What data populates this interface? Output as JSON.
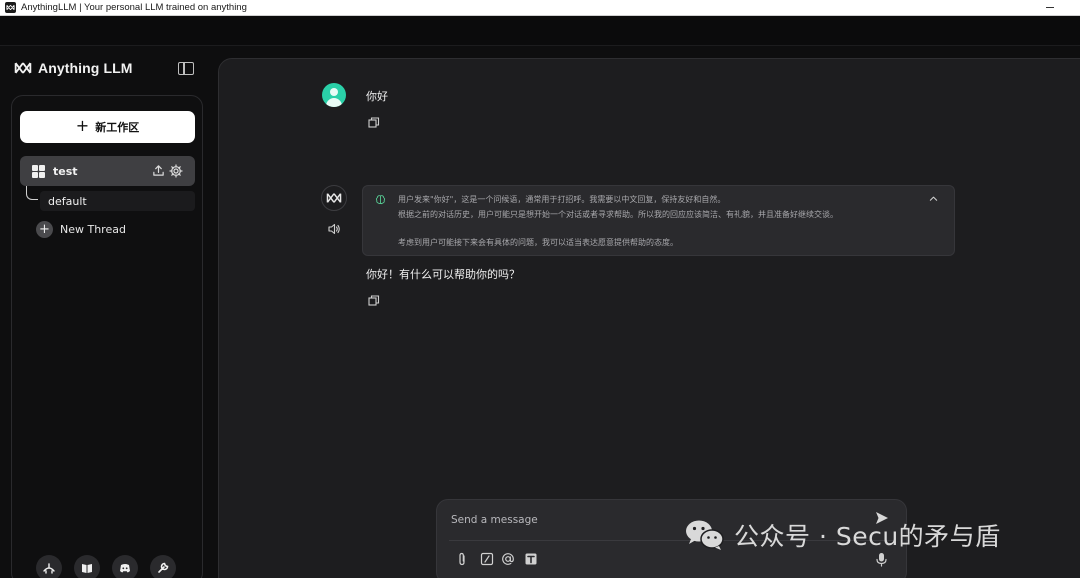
{
  "window": {
    "title": "AnythingLLM | Your personal LLM trained on anything"
  },
  "sidebar": {
    "brand": "Anything LLM",
    "new_workspace_label": "新工作区",
    "workspace": {
      "name": "test",
      "threads": [
        {
          "name": "default"
        }
      ]
    },
    "new_thread_label": "New Thread",
    "footer_icons": [
      "community-hub-icon",
      "docs-book-icon",
      "discord-icon",
      "settings-wrench-icon"
    ]
  },
  "chat": {
    "messages": [
      {
        "role": "user",
        "text": "你好"
      },
      {
        "role": "assistant",
        "thought": [
          "用户发来\"你好\"，这是一个问候语，通常用于打招呼。我需要以中文回复，保持友好和自然。",
          "根据之前的对话历史，用户可能只是想开始一个对话或者寻求帮助。所以我的回应应该简洁、有礼貌，并且准备好继续交谈。",
          "考虑到用户可能接下来会有具体的问题，我可以适当表达愿意提供帮助的态度。"
        ],
        "text": "你好！有什么可以帮助你的吗？"
      }
    ]
  },
  "composer": {
    "placeholder": "Send a message"
  },
  "watermark": {
    "text": "公众号 · Secu的矛与盾"
  },
  "colors": {
    "accent_avatar": "#2ad0a8",
    "background": "#0e0e0f",
    "panel": "#1d1d1f",
    "workspace_active": "#3f3f42"
  }
}
